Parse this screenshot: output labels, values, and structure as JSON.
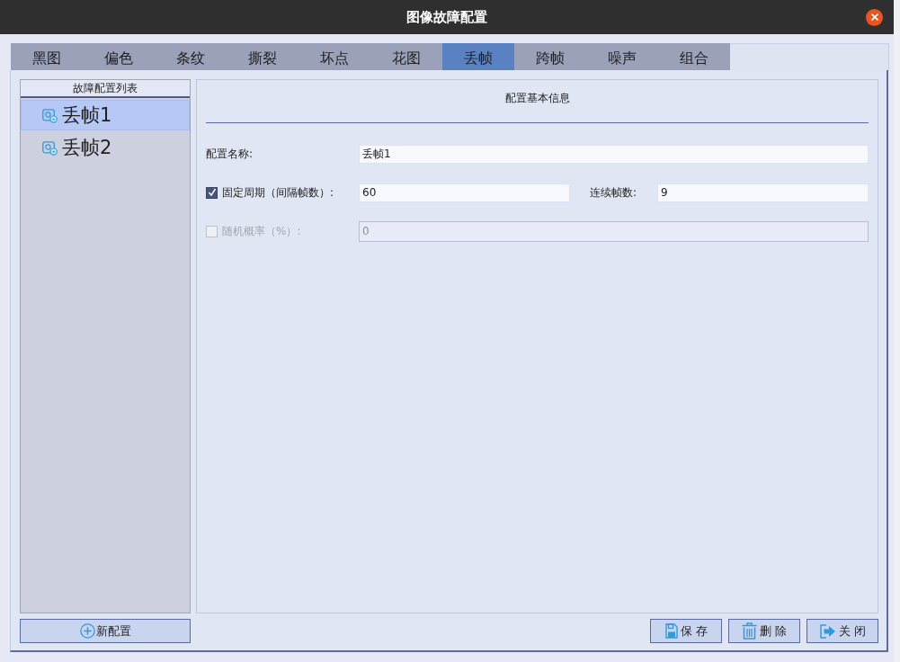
{
  "window": {
    "title": "图像故障配置"
  },
  "tabs": [
    {
      "label": "黑图",
      "selected": false
    },
    {
      "label": "偏色",
      "selected": false
    },
    {
      "label": "条纹",
      "selected": false
    },
    {
      "label": "撕裂",
      "selected": false
    },
    {
      "label": "坏点",
      "selected": false
    },
    {
      "label": "花图",
      "selected": false
    },
    {
      "label": "丢帧",
      "selected": true
    },
    {
      "label": "跨帧",
      "selected": false
    },
    {
      "label": "噪声",
      "selected": false
    },
    {
      "label": "组合",
      "selected": false
    }
  ],
  "config_list": {
    "title": "故障配置列表",
    "items": [
      {
        "label": "丢帧1",
        "selected": true
      },
      {
        "label": "丢帧2",
        "selected": false
      }
    ],
    "new_button": "新配置"
  },
  "form": {
    "title": "配置基本信息",
    "rows": [
      {
        "kind": "text",
        "label": "配置名称:",
        "value": "丢帧1"
      },
      {
        "kind": "checkbox",
        "label": "固定周期（间隔帧数）:",
        "checked": true,
        "disabled": false,
        "value": "60",
        "second": {
          "label": "连续帧数:",
          "value": "9"
        }
      },
      {
        "kind": "checkbox",
        "label": "随机概率（%）:",
        "checked": false,
        "disabled": true,
        "value": "0"
      }
    ]
  },
  "buttons": [
    {
      "kind": "save",
      "label": "保存"
    },
    {
      "kind": "delete",
      "label": "删除"
    },
    {
      "kind": "close",
      "label": "关闭"
    }
  ]
}
